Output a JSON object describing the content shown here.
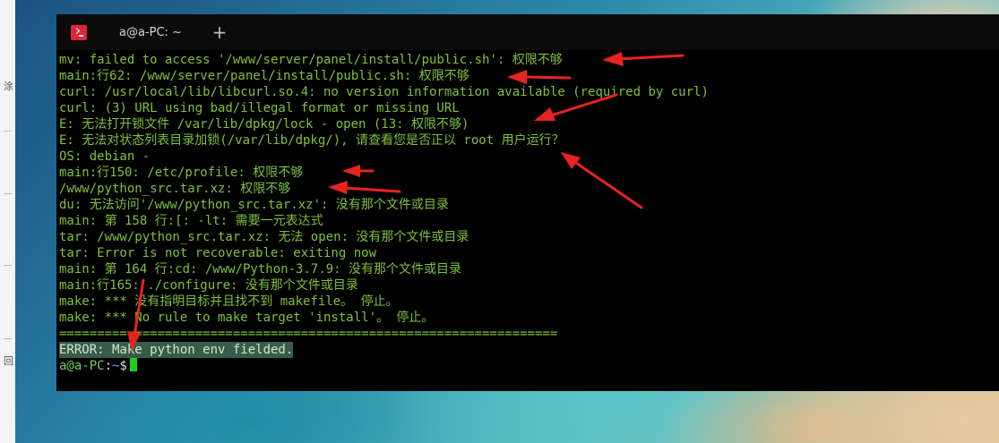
{
  "background_window": {
    "edge_chars": [
      "涂",
      "回"
    ]
  },
  "terminal": {
    "tab_title": "a@a-PC: ~",
    "new_tab_glyph": "+",
    "lines": [
      "mv: failed to access '/www/server/panel/install/public.sh': 权限不够",
      "main:行62: /www/server/panel/install/public.sh: 权限不够",
      "curl: /usr/local/lib/libcurl.so.4: no version information available (required by curl)",
      "curl: (3) URL using bad/illegal format or missing URL",
      "E: 无法打开锁文件 /var/lib/dpkg/lock - open (13: 权限不够)",
      "E: 无法对状态列表目录加锁(/var/lib/dpkg/), 请查看您是否正以 root 用户运行？",
      "OS: debian -",
      "main:行150: /etc/profile: 权限不够",
      "/www/python_src.tar.xz: 权限不够",
      "du: 无法访问'/www/python_src.tar.xz': 没有那个文件或目录",
      "main: 第 158 行:[: -lt: 需要一元表达式",
      "tar: /www/python_src.tar.xz: 无法 open: 没有那个文件或目录",
      "tar: Error is not recoverable: exiting now",
      "main: 第 164 行:cd: /www/Python-3.7.9: 没有那个文件或目录",
      "main:行165: ./configure: 没有那个文件或目录",
      "make: *** 没有指明目标并且找不到 makefile。 停止。",
      "make: *** No rule to make target 'install'。 停止。",
      "==================================================================",
      "ERROR: Make python env fielded."
    ],
    "prompt": {
      "user_host": "a@a-PC",
      "colon": ":",
      "path": "~",
      "sign": "$"
    }
  },
  "colors": {
    "terminal_bg": "#000000",
    "text_green": "#7cc23a",
    "error_highlight_bg": "#3a5a4a",
    "tab_icon_red": "#d8283b",
    "annotation_red": "#e8231f",
    "cursor_green": "#20d020"
  },
  "annotations": {
    "icon": "red-arrow-icon",
    "count": 7
  }
}
